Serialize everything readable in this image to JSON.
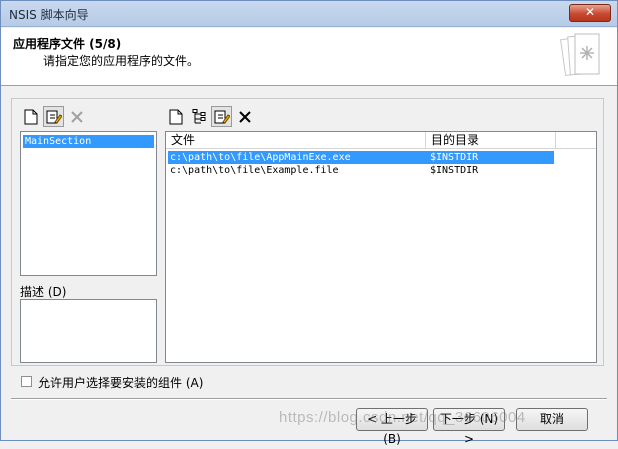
{
  "window": {
    "title": "NSIS 脚本向导",
    "close_label": "✕"
  },
  "header": {
    "title": "应用程序文件 (5/8)",
    "subtitle": "请指定您的应用程序的文件。",
    "icon": "document-stack-icon"
  },
  "sections": {
    "items": [
      {
        "label": "MainSection",
        "selected": true
      }
    ],
    "description_label": "描述 (D)"
  },
  "files": {
    "columns": [
      "文件",
      "目的目录"
    ],
    "rows": [
      {
        "file": "c:\\path\\to\\file\\AppMainExe.exe",
        "dest": "$INSTDIR",
        "selected": true
      },
      {
        "file": "c:\\path\\to\\file\\Example.file",
        "dest": "$INSTDIR",
        "selected": false
      }
    ]
  },
  "options": {
    "allow_select_label": "允许用户选择要安装的组件 (A)",
    "checked": false
  },
  "buttons": {
    "back": "< 上一步 (B)",
    "next": "下一步 (N) >",
    "cancel": "取消"
  },
  "watermark": "https://blog.csdn.net/qq_36606004"
}
